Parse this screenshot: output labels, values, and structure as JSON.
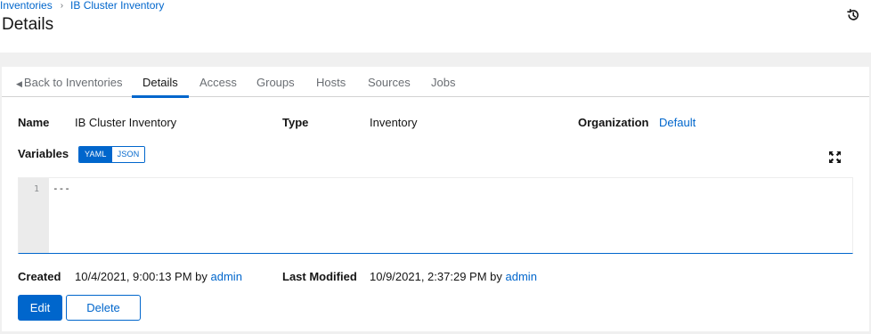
{
  "breadcrumb": {
    "root": "Inventories",
    "separator": "›",
    "current": "IB Cluster Inventory"
  },
  "page": {
    "title": "Details",
    "history_icon": "history-icon"
  },
  "tabs": [
    {
      "label": "Back to Inventories",
      "icon": "caret-left-icon"
    },
    {
      "label": "Details",
      "active": true
    },
    {
      "label": "Access"
    },
    {
      "label": "Groups"
    },
    {
      "label": "Hosts"
    },
    {
      "label": "Sources"
    },
    {
      "label": "Jobs"
    }
  ],
  "details": {
    "name_label": "Name",
    "name_value": "IB Cluster Inventory",
    "type_label": "Type",
    "type_value": "Inventory",
    "org_label": "Organization",
    "org_value": "Default",
    "variables_label": "Variables",
    "yaml_label": "YAML",
    "json_label": "JSON",
    "selected_format": "YAML",
    "expand_icon": "expand-icon"
  },
  "editor": {
    "line_number": "1",
    "content": "---"
  },
  "footer": {
    "created_label": "Created",
    "created_value": "10/4/2021, 9:00:13 PM by",
    "created_by": "admin",
    "modified_label": "Last Modified",
    "modified_value": "10/9/2021, 2:37:29 PM by",
    "modified_by": "admin"
  },
  "actions": {
    "edit_label": "Edit",
    "delete_label": "Delete"
  },
  "colors": {
    "accent": "#0066cc",
    "background": "#f0f0f0",
    "text": "#151515",
    "muted": "#6a6e73"
  }
}
